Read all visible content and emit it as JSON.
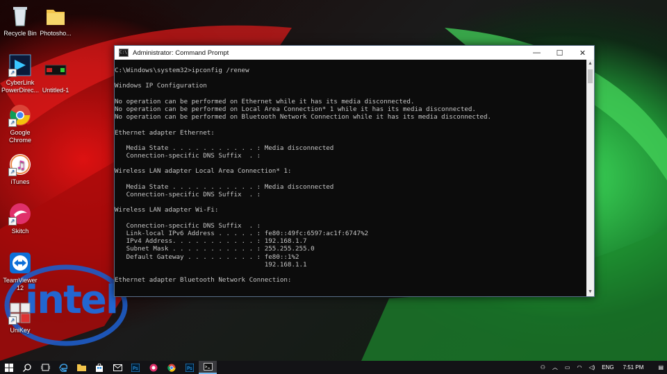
{
  "desktop": {
    "icons": [
      {
        "label": "Recycle Bin",
        "icon": "recycle-bin-icon"
      },
      {
        "label": "Photosho...",
        "icon": "folder-icon"
      },
      {
        "label": "CyberLink PowerDirec...",
        "icon": "cyberlink-powerdirector-icon"
      },
      {
        "label": "Untitled-1",
        "icon": "image-file-icon"
      },
      {
        "label": "Google Chrome",
        "icon": "chrome-icon"
      },
      {
        "label": "iTunes",
        "icon": "itunes-icon"
      },
      {
        "label": "Skitch",
        "icon": "skitch-icon"
      },
      {
        "label": "TeamViewer 12",
        "icon": "teamviewer-icon"
      },
      {
        "label": "UniKey",
        "icon": "unikey-icon"
      }
    ],
    "wallpaper_logo": "intel"
  },
  "window": {
    "title": "Administrator: Command Prompt",
    "app_icon_text": "C:\\",
    "controls": {
      "minimize": "—",
      "maximize": "☐",
      "close": "✕"
    },
    "lines": [
      "C:\\Windows\\system32>ipconfig /renew",
      "",
      "Windows IP Configuration",
      "",
      "No operation can be performed on Ethernet while it has its media disconnected.",
      "No operation can be performed on Local Area Connection* 1 while it has its media disconnected.",
      "No operation can be performed on Bluetooth Network Connection while it has its media disconnected.",
      "",
      "Ethernet adapter Ethernet:",
      "",
      "   Media State . . . . . . . . . . . : Media disconnected",
      "   Connection-specific DNS Suffix  . :",
      "",
      "Wireless LAN adapter Local Area Connection* 1:",
      "",
      "   Media State . . . . . . . . . . . : Media disconnected",
      "   Connection-specific DNS Suffix  . :",
      "",
      "Wireless LAN adapter Wi-Fi:",
      "",
      "   Connection-specific DNS Suffix  . :",
      "   Link-local IPv6 Address . . . . . : fe80::49fc:6597:ac1f:6747%2",
      "   IPv4 Address. . . . . . . . . . . : 192.168.1.7",
      "   Subnet Mask . . . . . . . . . . . : 255.255.255.0",
      "   Default Gateway . . . . . . . . . : fe80::1%2",
      "                                       192.168.1.1",
      "",
      "Ethernet adapter Bluetooth Network Connection:"
    ]
  },
  "taskbar": {
    "items": [
      {
        "icon": "start-icon",
        "active": false
      },
      {
        "icon": "search-icon",
        "active": false
      },
      {
        "icon": "task-view-icon",
        "active": false
      },
      {
        "icon": "edge-icon",
        "active": false
      },
      {
        "icon": "file-explorer-icon",
        "active": false
      },
      {
        "icon": "store-icon",
        "active": false
      },
      {
        "icon": "mail-icon",
        "active": false
      },
      {
        "icon": "photoshop-icon",
        "active": false
      },
      {
        "icon": "record-app-icon",
        "active": false
      },
      {
        "icon": "chrome-icon",
        "active": false
      },
      {
        "icon": "photoshop-icon-2",
        "active": false
      },
      {
        "icon": "command-prompt-icon",
        "active": true
      }
    ],
    "tray": {
      "language": "ENG",
      "time": "7:51 PM"
    }
  }
}
